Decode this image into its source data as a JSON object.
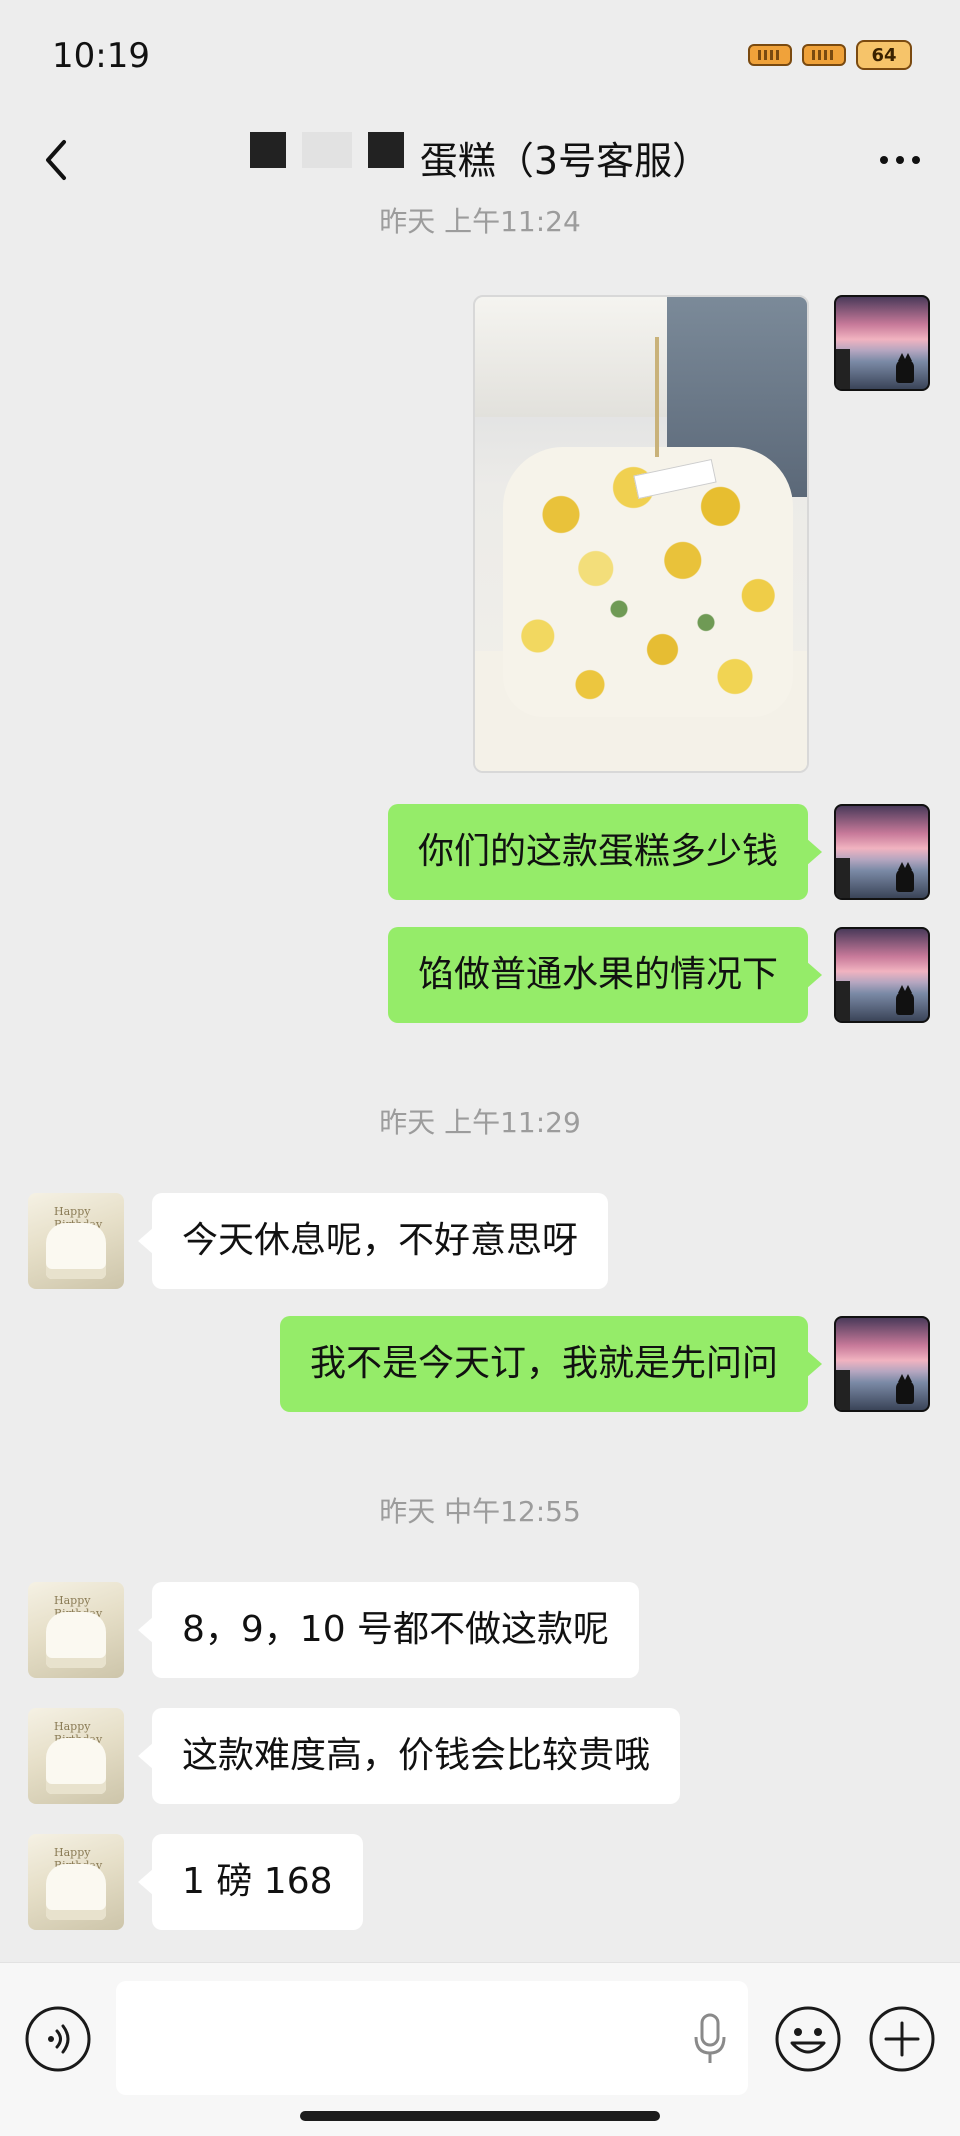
{
  "status_bar": {
    "time": "10:19",
    "battery_level": "64"
  },
  "header": {
    "title": "蛋糕（3号客服）"
  },
  "messages": [
    {
      "type": "timestamp",
      "text": "昨天 上午11:24"
    },
    {
      "type": "image",
      "sender": "me",
      "alt": "yellow flower birthday cake photo"
    },
    {
      "type": "text",
      "sender": "me",
      "text": "你们的这款蛋糕多少钱"
    },
    {
      "type": "text",
      "sender": "me",
      "text": "馅做普通水果的情况下"
    },
    {
      "type": "timestamp",
      "text": "昨天 上午11:29"
    },
    {
      "type": "text",
      "sender": "them",
      "text": "今天休息呢，不好意思呀"
    },
    {
      "type": "text",
      "sender": "me",
      "text": "我不是今天订，我就是先问问"
    },
    {
      "type": "timestamp",
      "text": "昨天 中午12:55"
    },
    {
      "type": "text",
      "sender": "them",
      "text": "8，9，10 号都不做这款呢"
    },
    {
      "type": "text",
      "sender": "them",
      "text": "这款难度高，价钱会比较贵哦"
    },
    {
      "type": "text",
      "sender": "them",
      "text": "1 磅 168"
    }
  ],
  "input": {
    "value": ""
  },
  "colors": {
    "my_bubble": "#95ec69",
    "their_bubble": "#ffffff",
    "background": "#ededed"
  }
}
